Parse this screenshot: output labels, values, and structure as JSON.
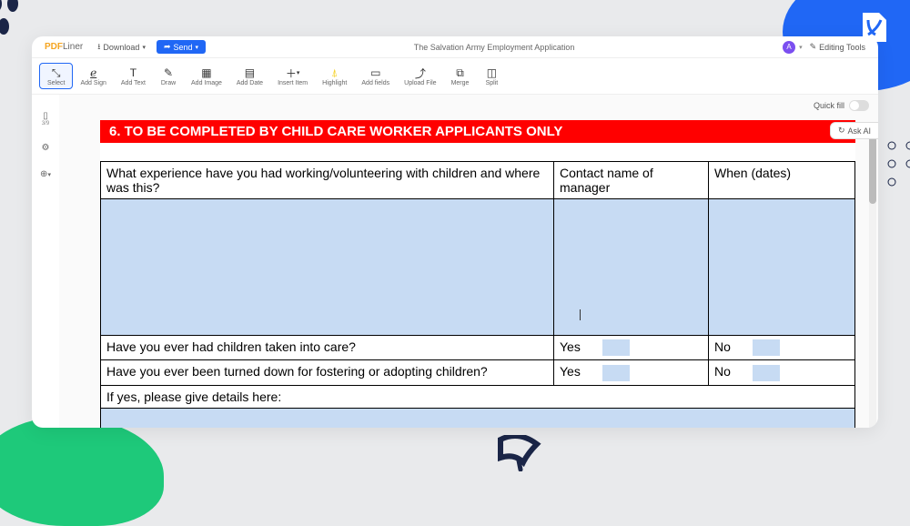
{
  "brand": {
    "name": "PDF",
    "suffix": "Liner"
  },
  "header": {
    "download": "Download",
    "send": "Send",
    "docTitle": "The Salvation Army Employment Application",
    "avatarLetter": "A",
    "editingTools": "Editing Tools"
  },
  "toolbar": {
    "select": "Select",
    "addSign": "Add Sign",
    "addText": "Add Text",
    "draw": "Draw",
    "addImage": "Add Image",
    "addDate": "Add Date",
    "insertItem": "Insert Item",
    "highlight": "Highlight",
    "addFields": "Add fields",
    "uploadFile": "Upload File",
    "merge": "Merge",
    "split": "Split"
  },
  "leftRail": {
    "pageCount": "3/9"
  },
  "quickFill": "Quick fill",
  "askAI": "Ask AI",
  "doc": {
    "sectionHeader": "6. TO BE COMPLETED BY CHILD CARE WORKER APPLICANTS ONLY",
    "q1": "What experience have you had working/volunteering with children and where was this?",
    "q1col2": "Contact name of manager",
    "q1col3": "When (dates)",
    "q2": "Have you ever had children taken into care?",
    "q3": "Have you ever been turned down for fostering or adopting children?",
    "yes": "Yes",
    "no": "No",
    "q4": "If yes, please give details here:"
  }
}
